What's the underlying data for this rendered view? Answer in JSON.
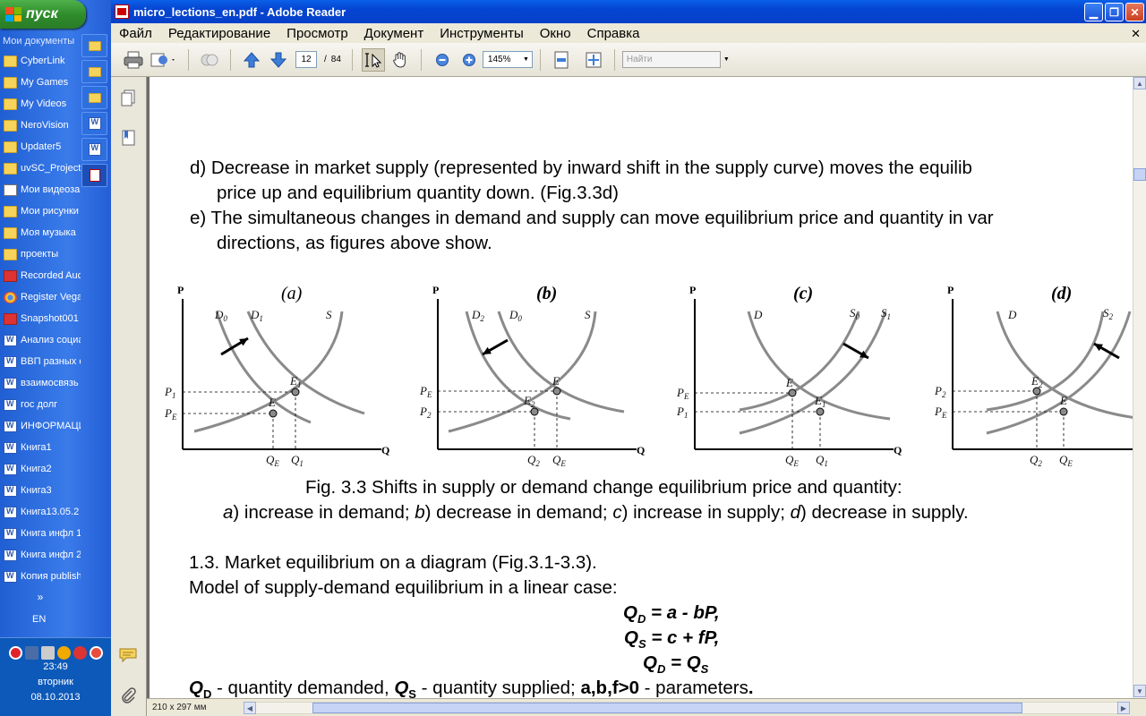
{
  "taskbar": {
    "start_label": "пуск",
    "header": "Мои документы",
    "items": [
      {
        "label": "CyberLink",
        "icon": "folder-icon"
      },
      {
        "label": "My Games",
        "icon": "folder-icon"
      },
      {
        "label": "My Videos",
        "icon": "folder-icon"
      },
      {
        "label": "NeroVision",
        "icon": "folder-icon"
      },
      {
        "label": "Updater5",
        "icon": "folder-icon"
      },
      {
        "label": "uvSC_Project",
        "icon": "folder-icon"
      },
      {
        "label": "Мои видеоза",
        "icon": "media-icon"
      },
      {
        "label": "Мои рисунки",
        "icon": "folder-icon"
      },
      {
        "label": "Моя музыка",
        "icon": "folder-icon"
      },
      {
        "label": "проекты",
        "icon": "folder-icon"
      },
      {
        "label": "Recorded Auc",
        "icon": "red-app-icon"
      },
      {
        "label": "Register Vega",
        "icon": "chrome-icon"
      },
      {
        "label": "Snapshot001",
        "icon": "pdf-file-icon"
      },
      {
        "label": "Анализ социа",
        "icon": "word-doc-icon"
      },
      {
        "label": "ВВП разных с",
        "icon": "word-doc-icon"
      },
      {
        "label": "взаимосвязь",
        "icon": "word-doc-icon"
      },
      {
        "label": "гос долг",
        "icon": "word-doc-icon"
      },
      {
        "label": "ИНФОРМАЦИ",
        "icon": "word-doc-icon"
      },
      {
        "label": "Книга1",
        "icon": "word-doc-icon"
      },
      {
        "label": "Книга2",
        "icon": "word-doc-icon"
      },
      {
        "label": "Книга3",
        "icon": "word-doc-icon"
      },
      {
        "label": "Книга13.05.2",
        "icon": "word-doc-icon"
      },
      {
        "label": "Книга инфл 1",
        "icon": "word-doc-icon"
      },
      {
        "label": "Книга инфл 2",
        "icon": "word-doc-icon"
      },
      {
        "label": "Копия publish",
        "icon": "word-doc-icon"
      }
    ],
    "more": "»",
    "lang": "EN",
    "time": "23:49",
    "weekday": "вторник",
    "date": "08.10.2013"
  },
  "window": {
    "title": "micro_lections_en.pdf - Adobe Reader",
    "menu": [
      "Файл",
      "Редактирование",
      "Просмотр",
      "Документ",
      "Инструменты",
      "Окно",
      "Справка"
    ],
    "page_current": "12",
    "page_separator": "/",
    "page_total": "84",
    "zoom": "145%",
    "find_placeholder": "Найти",
    "page_size": "210 x 297 мм"
  },
  "document": {
    "para_d1": "d)  Decrease in market supply (represented by inward shift in  the supply curve) moves the equilib",
    "para_d2": "price up and equilibrium quantity down. (Fig.3.3d)",
    "para_e1": "e)  The simultaneous changes in demand and supply can move equilibrium price and quantity in var",
    "para_e2": "directions, as figures above show.",
    "fig_caption1": "Fig. 3.3   Shifts in supply or demand change equilibrium price and quantity:",
    "fig_caption2_a": "a",
    "fig_caption2_a_text": ") increase in demand; ",
    "fig_caption2_b": "b",
    "fig_caption2_b_text": ") decrease in demand; ",
    "fig_caption2_c": "c",
    "fig_caption2_c_text": ") increase in supply; ",
    "fig_caption2_d": "d",
    "fig_caption2_d_text": ") decrease in supply.",
    "section_title": "1.3. Market equilibrium on a diagram (Fig.3.1-3.3).",
    "model_line": "Model of supply-demand equilibrium in a linear case:",
    "eq1_lhs": "Q",
    "eq1_sub": "D",
    "eq1_rhs": " = a - bP,",
    "eq2_lhs": "Q",
    "eq2_sub": "S",
    "eq2_rhs": " = c + fP,",
    "eq3_lhs": "Q",
    "eq3_sub": "D",
    "eq3_mid": " = Q",
    "eq3_sub2": "S",
    "last_qd": "Q",
    "last_qd_sub": "D",
    "last_qd_text": " - quantity demanded, ",
    "last_qs": "Q",
    "last_qs_sub": "S",
    "last_qs_text": " - quantity supplied; ",
    "last_params": "a,b,f>0",
    "last_params_text": " - parameters",
    "last_period": "."
  },
  "figures": {
    "axis_p": "P",
    "axis_q": "Q",
    "panels": [
      {
        "title": "a",
        "curves": [
          "D0",
          "D1",
          "S"
        ],
        "prices": [
          "P1",
          "PE"
        ],
        "quantities": [
          "QE",
          "Q1"
        ],
        "points": [
          "E1",
          "E"
        ]
      },
      {
        "title": "b",
        "curves": [
          "D2",
          "D0",
          "S"
        ],
        "prices": [
          "PE",
          "P2"
        ],
        "quantities": [
          "Q2",
          "QE"
        ],
        "points": [
          "E",
          "E2"
        ]
      },
      {
        "title": "c",
        "curves": [
          "D",
          "S0",
          "S1"
        ],
        "prices": [
          "PE",
          "P1"
        ],
        "quantities": [
          "QE",
          "Q1"
        ],
        "points": [
          "E",
          "E1"
        ]
      },
      {
        "title": "d",
        "curves": [
          "D",
          "S2"
        ],
        "prices": [
          "P2",
          "PE"
        ],
        "quantities": [
          "Q2",
          "QE"
        ],
        "points": [
          "E2",
          "E"
        ]
      }
    ]
  }
}
